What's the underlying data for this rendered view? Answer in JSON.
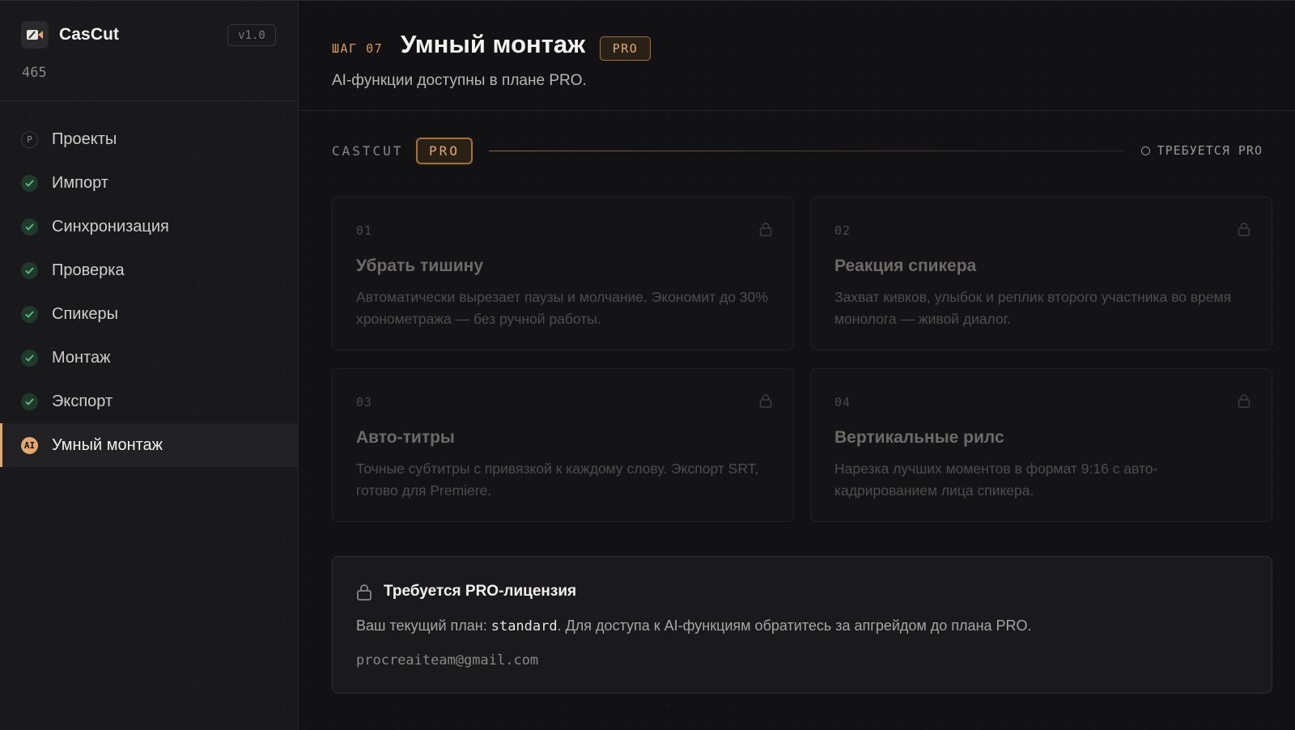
{
  "app": {
    "name": "CasCut",
    "version": "v1.0",
    "counter": "465"
  },
  "sidebar": {
    "items": [
      {
        "label": "Проекты",
        "icon": "p",
        "state": "pending"
      },
      {
        "label": "Импорт",
        "icon": "check-icon",
        "state": "done"
      },
      {
        "label": "Синхронизация",
        "icon": "check-icon",
        "state": "done"
      },
      {
        "label": "Проверка",
        "icon": "check-icon",
        "state": "done"
      },
      {
        "label": "Спикеры",
        "icon": "check-icon",
        "state": "done"
      },
      {
        "label": "Монтаж",
        "icon": "check-icon",
        "state": "done"
      },
      {
        "label": "Экспорт",
        "icon": "check-icon",
        "state": "done"
      },
      {
        "label": "Умный монтаж",
        "icon": "ai",
        "state": "active"
      }
    ],
    "icon_letters": {
      "projects": "P",
      "ai": "AI"
    }
  },
  "header": {
    "step": "ШАГ 07",
    "title": "Умный монтаж",
    "badge": "PRO",
    "subtitle": "AI-функции доступны в плане PRO."
  },
  "band": {
    "brand": "CASTCUT",
    "badge": "PRO",
    "status": "ТРЕБУЕТСЯ PRO"
  },
  "features": [
    {
      "num": "01",
      "title": "Убрать тишину",
      "desc": "Автоматически вырезает паузы и молчание. Экономит до 30% хронометража — без ручной работы."
    },
    {
      "num": "02",
      "title": "Реакция спикера",
      "desc": "Захват кивков, улыбок и реплик второго участника во время монолога — живой диалог."
    },
    {
      "num": "03",
      "title": "Авто-титры",
      "desc": "Точные субтитры с привязкой к каждому слову. Экспорт SRT, готово для Premiere."
    },
    {
      "num": "04",
      "title": "Вертикальные рилс",
      "desc": "Нарезка лучших моментов в формат 9:16 с авто-кадрированием лица спикера."
    }
  ],
  "notice": {
    "title": "Требуется PRO-лицензия",
    "text_before": "Ваш текущий план: ",
    "plan": "standard",
    "text_after": ". Для доступа к AI-функциям обратитесь за апгрейдом до плана PRO.",
    "email": "procreaiteam@gmail.com"
  },
  "colors": {
    "accent": "#e3a872",
    "background": "#121214",
    "sidebar": "#19191b",
    "done": "#5fbf86"
  }
}
